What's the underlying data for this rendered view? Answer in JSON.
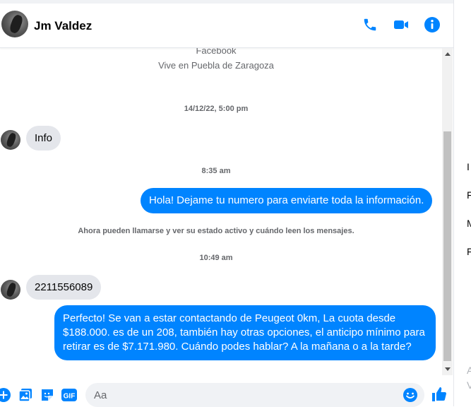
{
  "header": {
    "contact_name": "Jm Valdez",
    "icons": [
      "phone-icon",
      "video-camera-icon",
      "info-icon"
    ]
  },
  "conversation": {
    "intro_line1": "Facebook",
    "intro_line2": "Vive en Puebla de Zaragoza",
    "timestamp1": "14/12/22, 5:00 pm",
    "msg_in1": "Info",
    "timestamp2": "8:35 am",
    "msg_out1": "Hola! Dejame tu numero  para enviarte toda la información.",
    "system_notice": "Ahora pueden llamarse y ver su estado activo y cuándo leen los mensajes.",
    "timestamp3": "10:49 am",
    "msg_in2": "2211556089",
    "msg_out2": "Perfecto!  Se van a estar contactando de Peugeot 0km, La cuota desde $188.000. es de un 208, también hay otras opciones, el anticipo mínimo para retirar es de $7.171.980. Cuándo podes hablar? A la mañana o a la tarde?"
  },
  "composer": {
    "placeholder": "Aa",
    "gif_label": "GIF"
  },
  "right_panel": {
    "letters": [
      "I",
      "F",
      "M",
      "F",
      "A",
      "V"
    ]
  },
  "colors": {
    "accent": "#0084ff",
    "incoming_bubble": "#e4e6eb",
    "secondary_text": "#65676b"
  }
}
